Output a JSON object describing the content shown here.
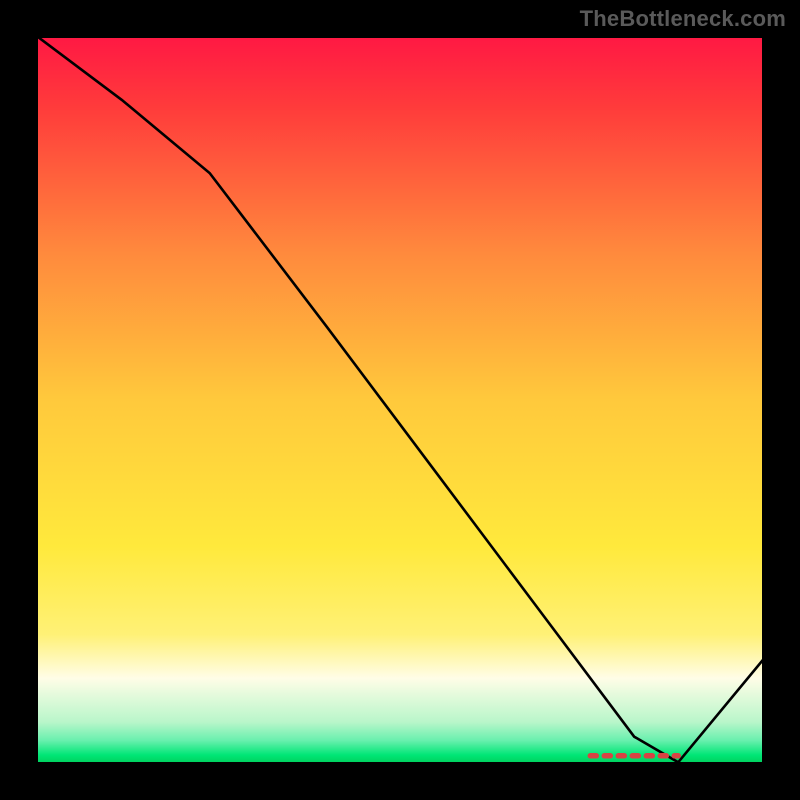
{
  "watermark": "TheBottleneck.com",
  "chart_data": {
    "type": "line",
    "title": "",
    "xlabel": "",
    "ylabel": "",
    "xlim": [
      0,
      100
    ],
    "ylim": [
      0,
      100
    ],
    "grid": false,
    "background": {
      "type": "vertical_gradient",
      "stops": [
        {
          "pos": 0.0,
          "color": "#ff1744"
        },
        {
          "pos": 0.1,
          "color": "#ff3b3b"
        },
        {
          "pos": 0.3,
          "color": "#ff8a3d"
        },
        {
          "pos": 0.5,
          "color": "#ffc93c"
        },
        {
          "pos": 0.7,
          "color": "#ffe93c"
        },
        {
          "pos": 0.82,
          "color": "#fff176"
        },
        {
          "pos": 0.88,
          "color": "#fffde7"
        },
        {
          "pos": 0.94,
          "color": "#b9f6ca"
        },
        {
          "pos": 0.965,
          "color": "#69f0ae"
        },
        {
          "pos": 0.985,
          "color": "#00e676"
        },
        {
          "pos": 1.0,
          "color": "#00c853"
        }
      ]
    },
    "series": [
      {
        "name": "curve",
        "color": "#000000",
        "x": [
          0,
          12,
          24,
          40,
          55,
          70,
          82,
          88,
          100
        ],
        "y": [
          100,
          91,
          81,
          60,
          40,
          20,
          4,
          0.5,
          15
        ]
      }
    ],
    "annotations": [
      {
        "name": "red-dotted-segment",
        "type": "dotted",
        "color": "#d84343",
        "x": [
          76,
          88
        ],
        "y": [
          1.4,
          1.4
        ]
      }
    ]
  }
}
